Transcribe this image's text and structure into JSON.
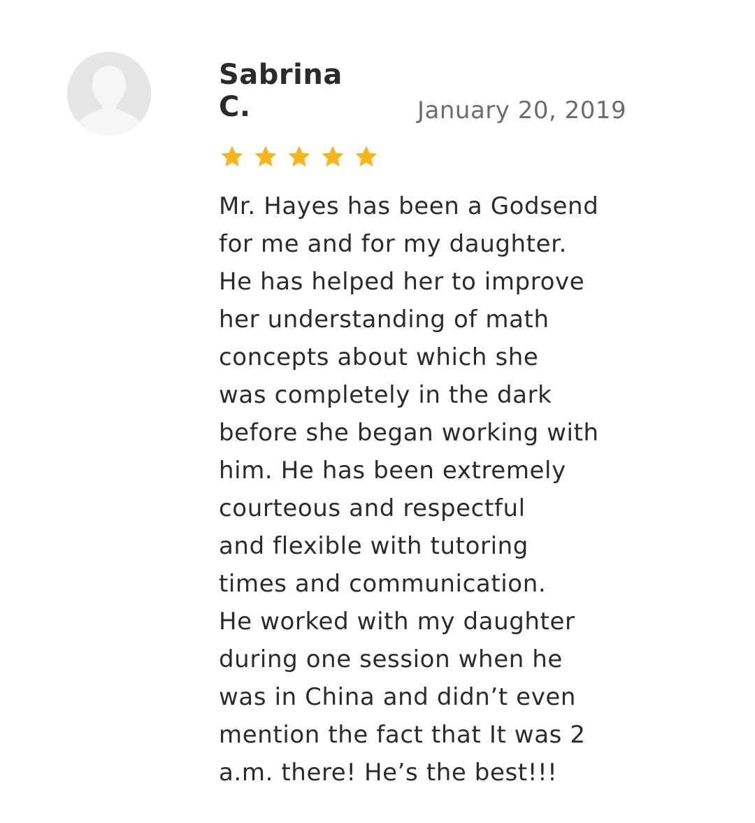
{
  "review": {
    "reviewer_name": "Sabrina\nC.",
    "date": "January 20, 2019",
    "rating": 5,
    "rating_max": 5,
    "star_color": "#f6b51e",
    "avatar_icon": "user-silhouette-icon",
    "star_icon": "star-icon",
    "text": "Mr. Hayes has been a Godsend\nfor me and for my daughter.\nHe has helped her to improve\nher understanding of math\nconcepts about which she\nwas completely in the dark\nbefore she began working with\nhim. He has been extremely\ncourteous and respectful\nand flexible with tutoring\ntimes and communication.\nHe worked with my daughter\nduring one session when he\nwas in China and didn’t even\nmention the fact that It was 2\na.m. there!  He’s the best!!!"
  }
}
